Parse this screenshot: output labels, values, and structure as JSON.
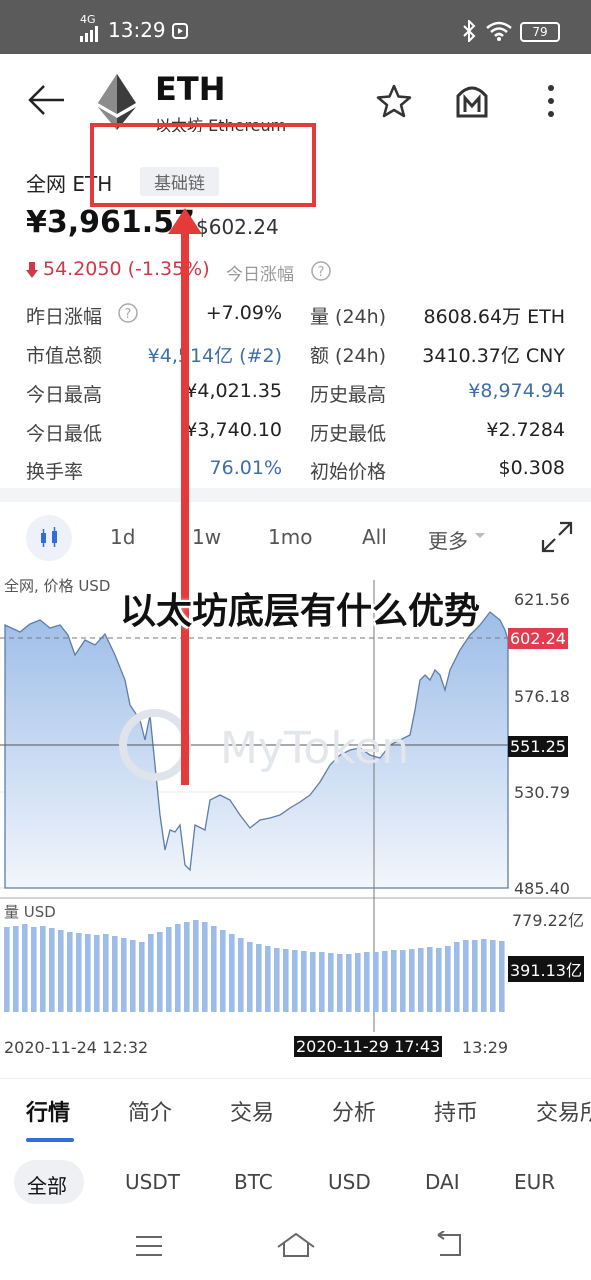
{
  "status": {
    "network": "4G",
    "time": "13:29",
    "battery": "79"
  },
  "header": {
    "symbol": "ETH",
    "name": "以太坊 Ethereum"
  },
  "market": {
    "label": "全网 ETH",
    "chain_badge": "基础链"
  },
  "price": {
    "cny": "¥3,961.57",
    "usd": "$602.24",
    "change": "54.2050 (-1.35%)",
    "change_label": "今日涨幅"
  },
  "stats": [
    {
      "label": "昨日涨幅",
      "value": "+7.09%",
      "label2": "量 (24h)",
      "value2": "8608.64万 ETH"
    },
    {
      "label": "市值总额",
      "value": "¥4,514亿 (#2)",
      "label2": "额 (24h)",
      "value2": "3410.37亿 CNY"
    },
    {
      "label": "今日最高",
      "value": "¥4,021.35",
      "label2": "历史最高",
      "value2": "¥8,974.94"
    },
    {
      "label": "今日最低",
      "value": "¥3,740.10",
      "label2": "历史最低",
      "value2": "¥2.7284"
    },
    {
      "label": "换手率",
      "value": "76.01%",
      "label2": "初始价格",
      "value2": "$0.308"
    }
  ],
  "chart_tabs": [
    "1d",
    "1w",
    "1mo",
    "All",
    "更多"
  ],
  "chart": {
    "price_label": "全网, 价格",
    "price_unit": "USD",
    "volume_label": "量 USD",
    "y_ticks": [
      "621.56",
      "576.18",
      "530.79",
      "485.40"
    ],
    "current_price_tag": "602.24",
    "crosshair_price_tag": "551.25",
    "volume_ticks": [
      "779.22亿"
    ],
    "crosshair_volume_tag": "391.13亿",
    "x_start": "2020-11-24 12:32",
    "x_crosshair": "2020-11-29 17:43",
    "x_end": "13:29",
    "watermark": "MyToken"
  },
  "overlay_title": "以太坊底层有什么优势",
  "bottom_tabs": [
    "行情",
    "简介",
    "交易",
    "分析",
    "持币",
    "交易所"
  ],
  "sub_tabs": [
    "全部",
    "USDT",
    "BTC",
    "USD",
    "DAI",
    "EUR"
  ],
  "colors": {
    "accent_red": "#d0384a",
    "chart_blue": "#9dbde8",
    "tab_active": "#2f6fd6"
  }
}
